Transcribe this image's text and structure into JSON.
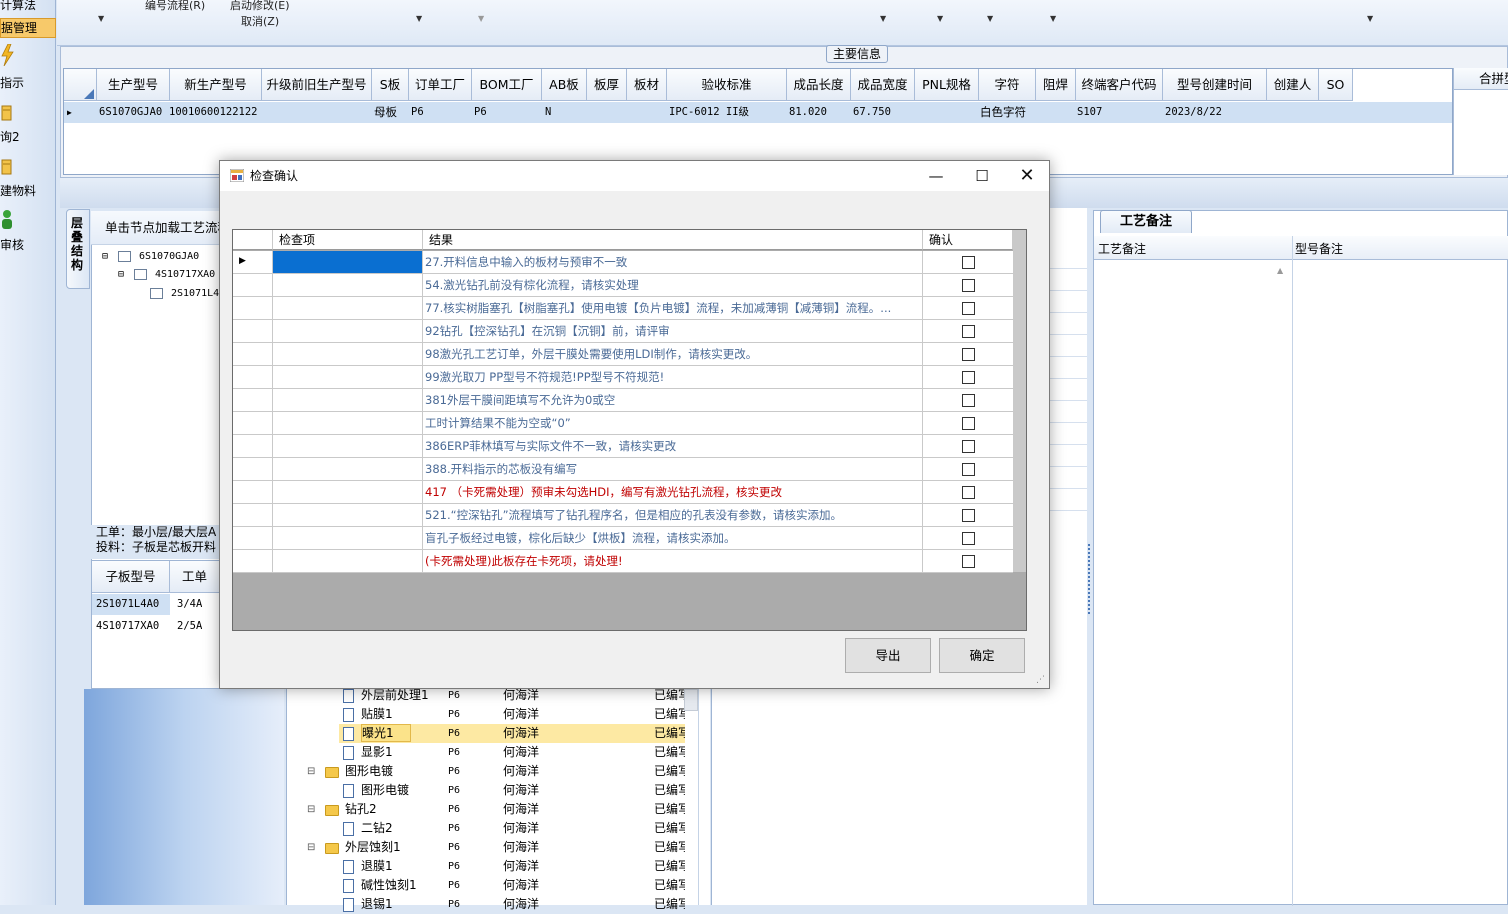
{
  "leftnav": {
    "items": [
      {
        "label": "计算法"
      },
      {
        "label": "据管理"
      },
      {
        "label": "指示"
      },
      {
        "label": "询2"
      },
      {
        "label": "建物料"
      },
      {
        "label": "审核"
      }
    ]
  },
  "toolbar": {
    "menu1": "编号流程(R)",
    "menu2": "启动修改(E)",
    "menu3": "取消(Z)"
  },
  "main": {
    "section_label": "主要信息",
    "columns": [
      "生产型号",
      "新生产型号",
      "升级前旧生产型号",
      "S板",
      "订单工厂",
      "BOM工厂",
      "AB板",
      "板厚",
      "板材",
      "验收标准",
      "成品长度",
      "成品宽度",
      "PNL规格",
      "字符",
      "阻焊",
      "终端客户代码",
      "型号创建时间",
      "创建人",
      "SO"
    ],
    "row": {
      "prod_model": "6S1070GJA0",
      "new_model": "10010600122122",
      "s_board": "母板",
      "order_factory": "P6",
      "bom_factory": "P6",
      "ab_board": "N",
      "standard": "IPC-6012 II级",
      "length": "81.020",
      "width": "67.750",
      "char": "白色字符",
      "client_code": "S107",
      "create_time": "2023/8/22"
    },
    "right_header": "合拼型"
  },
  "structure": {
    "vtab": "层叠结构",
    "header": "单击节点加载工艺流程",
    "nodes": [
      "6S1070GJA0",
      "4S10717XA0",
      "2S1071L4"
    ],
    "info_line1": "工单：最小层/最大层A",
    "info_line2": "投料：子板是芯板开料",
    "sub_columns": [
      "子板型号",
      "工单"
    ],
    "sub_rows": [
      {
        "model": "2S1071L4A0",
        "order": "3/4A"
      },
      {
        "model": "4S10717XA0",
        "order": "2/5A"
      }
    ]
  },
  "process": {
    "rows": [
      {
        "name": "外层前处理1",
        "factory": "P6",
        "person": "何海洋",
        "status": "已编写",
        "type": "doc"
      },
      {
        "name": "贴膜1",
        "factory": "P6",
        "person": "何海洋",
        "status": "已编写",
        "type": "doc"
      },
      {
        "name": "曝光1",
        "factory": "P6",
        "person": "何海洋",
        "status": "已编写",
        "type": "doc",
        "selected": true
      },
      {
        "name": "显影1",
        "factory": "P6",
        "person": "何海洋",
        "status": "已编写",
        "type": "doc"
      },
      {
        "name": "图形电镀",
        "factory": "P6",
        "person": "何海洋",
        "status": "已编写",
        "type": "folder"
      },
      {
        "name": "图形电镀",
        "factory": "P6",
        "person": "何海洋",
        "status": "已编写",
        "type": "doc"
      },
      {
        "name": "钻孔2",
        "factory": "P6",
        "person": "何海洋",
        "status": "已编写",
        "type": "folder"
      },
      {
        "name": "二钻2",
        "factory": "P6",
        "person": "何海洋",
        "status": "已编写",
        "type": "doc"
      },
      {
        "name": "外层蚀刻1",
        "factory": "P6",
        "person": "何海洋",
        "status": "已编写",
        "type": "folder"
      },
      {
        "name": "退膜1",
        "factory": "P6",
        "person": "何海洋",
        "status": "已编写",
        "type": "doc"
      },
      {
        "name": "碱性蚀刻1",
        "factory": "P6",
        "person": "何海洋",
        "status": "已编写",
        "type": "doc"
      },
      {
        "name": "退锡1",
        "factory": "P6",
        "person": "何海洋",
        "status": "已编写",
        "type": "doc"
      }
    ]
  },
  "notes": {
    "tab": "工艺备注",
    "col1": "工艺备注",
    "col2": "型号备注"
  },
  "dialog": {
    "title": "检查确认",
    "col_item": "检查项",
    "col_result": "结果",
    "col_confirm": "确认",
    "rows": [
      {
        "result": "27.开料信息中输入的板材与预审不一致",
        "red": false
      },
      {
        "result": "54.激光钻孔前没有棕化流程，请核实处理",
        "red": false
      },
      {
        "result": "77.核实树脂塞孔【树脂塞孔】使用电镀【负片电镀】流程，未加减薄铜【减薄铜】流程。...",
        "red": false
      },
      {
        "result": "92钻孔【控深钻孔】在沉铜【沉铜】前，请评审",
        "red": false
      },
      {
        "result": "98激光孔工艺订单，外层干膜处需要使用LDI制作，请核实更改。",
        "red": false
      },
      {
        "result": "99激光取刀 PP型号不符规范!PP型号不符规范!",
        "red": false
      },
      {
        "result": "381外层干膜间距填写不允许为0或空",
        "red": false
      },
      {
        "result": "工时计算结果不能为空或“0”",
        "red": false
      },
      {
        "result": "386ERP菲林填写与实际文件不一致，请核实更改",
        "red": false
      },
      {
        "result": "388.开料指示的芯板没有编写",
        "red": false
      },
      {
        "result": "417 （卡死需处理）预审未勾选HDI，编写有激光钻孔流程，核实更改",
        "red": true
      },
      {
        "result": "521.“控深钻孔”流程填写了钻孔程序名，但是相应的孔表没有参数，请核实添加。",
        "red": false
      },
      {
        "result": "盲孔子板经过电镀，棕化后缺少【烘板】流程，请核实添加。",
        "red": false
      },
      {
        "result": "(卡死需处理)此板存在卡死项，请处理!",
        "red": true
      }
    ],
    "export_label": "导出",
    "ok_label": "确定"
  }
}
